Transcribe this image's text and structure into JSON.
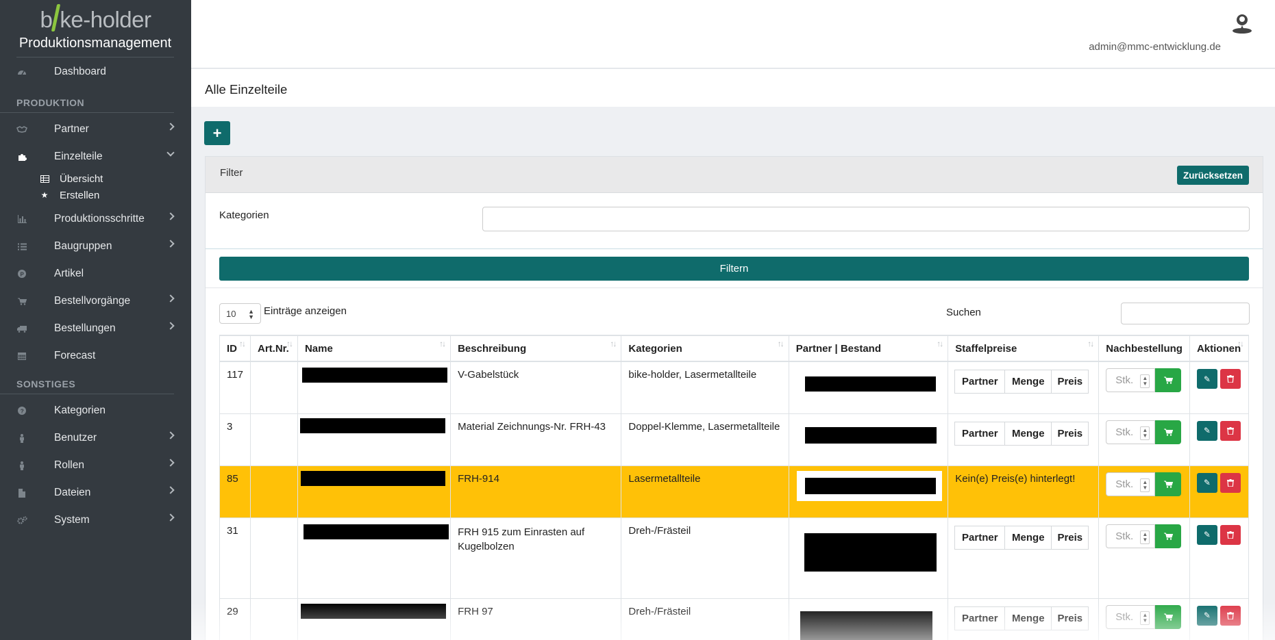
{
  "logo": {
    "left": "b",
    "right": "ke-holder"
  },
  "brand": "Produktionsmanagement",
  "sidebar": {
    "dashboard": "Dashboard",
    "section_produktion": "PRODUKTION",
    "partner": "Partner",
    "einzelteile": "Einzelteile",
    "uebersicht": "Übersicht",
    "erstellen": "Erstellen",
    "produktionsschritte": "Produktionsschritte",
    "baugruppen": "Baugruppen",
    "artikel": "Artikel",
    "bestellvorgaenge": "Bestellvorgänge",
    "bestellungen": "Bestellungen",
    "forecast": "Forecast",
    "section_sonstiges": "SONSTIGES",
    "kategorien": "Kategorien",
    "benutzer": "Benutzer",
    "rollen": "Rollen",
    "dateien": "Dateien",
    "system": "System"
  },
  "header": {
    "user_email": "admin@mmc-entwicklung.de"
  },
  "page": {
    "title": "Alle Einzelteile",
    "add_label": "+"
  },
  "filter": {
    "title": "Filter",
    "reset_label": "Zurücksetzen",
    "categories_label": "Kategorien",
    "categories_value": "",
    "submit_label": "Filtern"
  },
  "table_controls": {
    "page_length": "10",
    "page_length_suffix": "Einträge anzeigen",
    "search_label": "Suchen",
    "search_value": ""
  },
  "table": {
    "columns": [
      "ID",
      "Art.Nr.",
      "Name",
      "Beschreibung",
      "Kategorien",
      "Partner | Bestand",
      "Staffelpreise",
      "Nachbestellung",
      "Aktionen"
    ],
    "staffel_headers": [
      "Partner",
      "Menge",
      "Preis"
    ],
    "qty_placeholder": "Stk.",
    "rows": [
      {
        "id": "117",
        "artnr": "",
        "beschreibung": "V-Gabelstück",
        "kategorien": "bike-holder, Lasermetallteile",
        "staffel": ""
      },
      {
        "id": "3",
        "artnr": "",
        "beschreibung": "Material Zeichnungs-Nr. FRH-43",
        "kategorien": "Doppel-Klemme, Lasermetallteile",
        "staffel": ""
      },
      {
        "id": "85",
        "artnr": "",
        "beschreibung": "FRH-914",
        "kategorien": "Lasermetallteile",
        "staffel": "Kein(e) Preis(e) hinterlegt!"
      },
      {
        "id": "31",
        "artnr": "",
        "beschreibung": "FRH 915 zum Einrasten auf Kugelbolzen",
        "kategorien": "Dreh-/Frästeil",
        "staffel": ""
      },
      {
        "id": "29",
        "artnr": "",
        "beschreibung": "FRH 97",
        "kategorien": "Dreh-/Frästeil",
        "staffel": ""
      }
    ]
  },
  "colors": {
    "primary": "#0f6b6b",
    "sidebar": "#343a40",
    "warning": "#ffc107",
    "success": "#28a745",
    "danger": "#dc3545"
  }
}
